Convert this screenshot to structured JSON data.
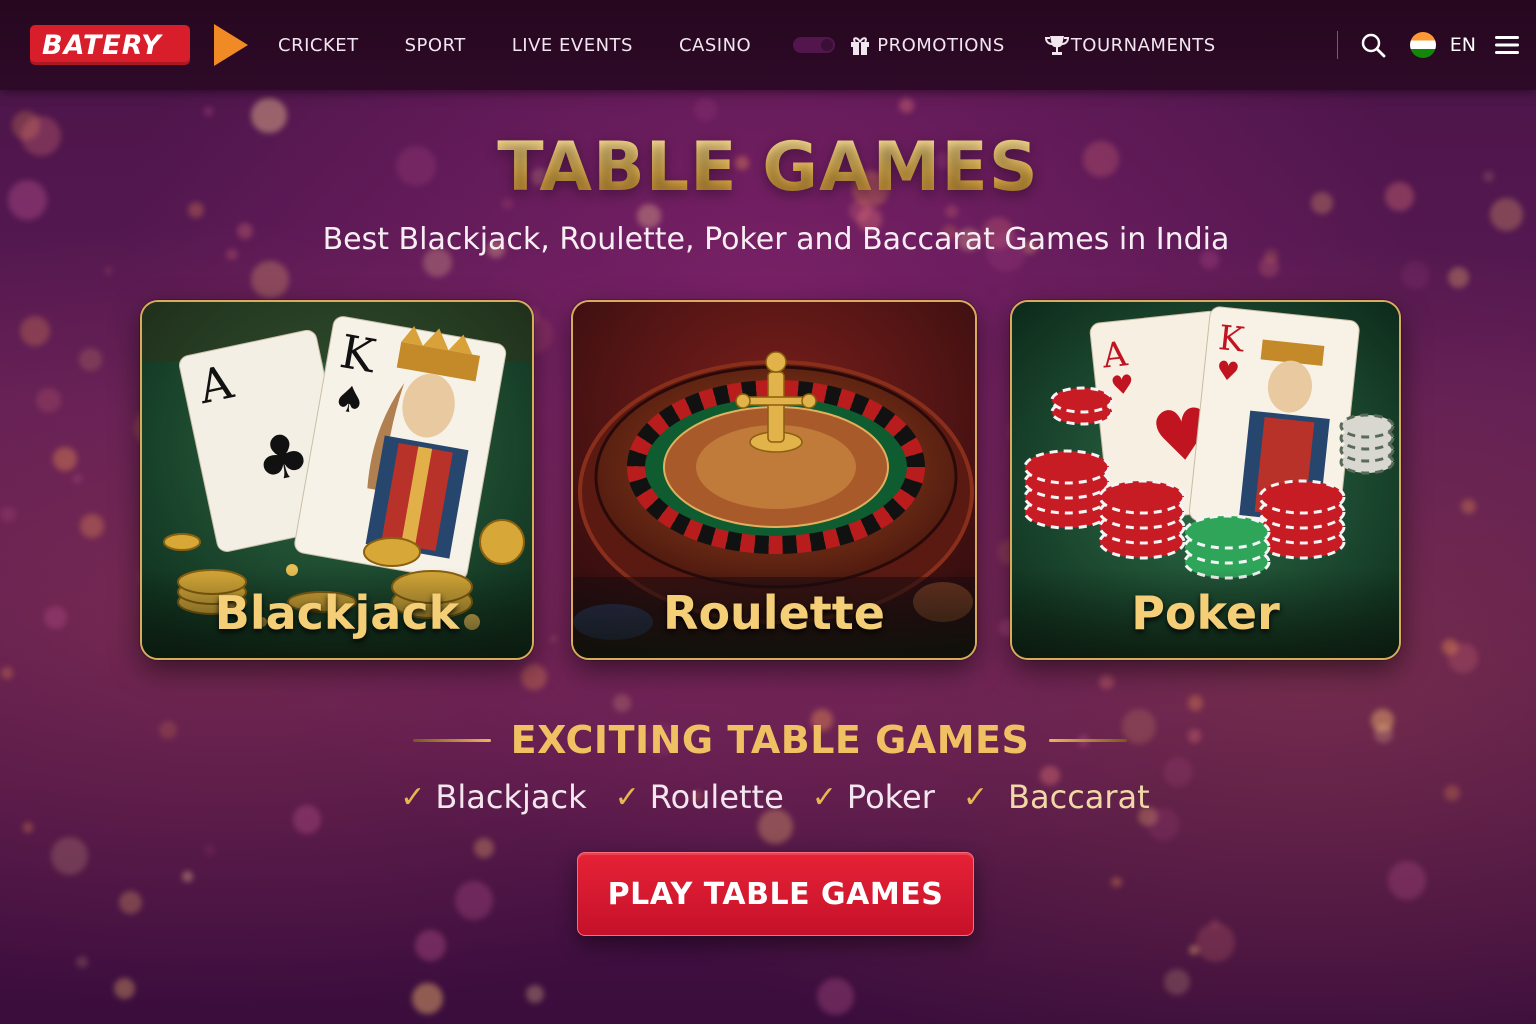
{
  "brand": {
    "name": "BATERY",
    "primary": "#d81e2a",
    "accent": "#f08a24",
    "gold": "#e9b751"
  },
  "nav": {
    "items": [
      {
        "label": "CRICKET"
      },
      {
        "label": "SPORT"
      },
      {
        "label": "LIVE EVENTS"
      },
      {
        "label": "CASINO"
      },
      {
        "label": "PROMOTIONS",
        "icon": "gift-icon"
      },
      {
        "label": "TOURNAMENTS",
        "icon": "trophy-icon"
      }
    ]
  },
  "tools": {
    "search_icon": "search-icon",
    "language": "EN",
    "flag": "india-flag-icon",
    "menu_icon": "hamburger-menu-icon"
  },
  "hero": {
    "title": "TABLE GAMES",
    "subtitle": "Best Blackjack, Roulette, Poker and Baccarat Games in India"
  },
  "cards": [
    {
      "label": "Blackjack"
    },
    {
      "label": "Roulette"
    },
    {
      "label": "Poker"
    }
  ],
  "exciting": {
    "title": "EXCITING TABLE GAMES",
    "items": [
      "Blackjack",
      "Roulette",
      "Poker",
      "Baccarat"
    ]
  },
  "cta": {
    "label": "PLAY TABLE GAMES"
  }
}
